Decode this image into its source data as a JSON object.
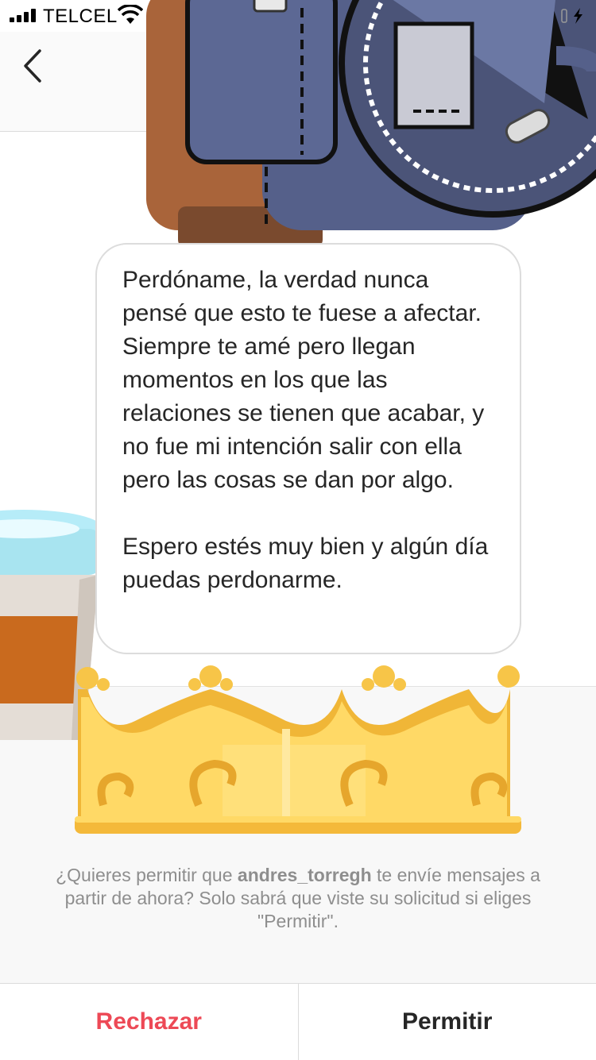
{
  "status_bar": {
    "carrier": "TELCEL",
    "icons": [
      "signal-icon",
      "wifi-icon",
      "charging-icon"
    ]
  },
  "header": {
    "back_icon": "chevron-left-icon"
  },
  "message": {
    "paragraphs": [
      "Perdóname, la verdad nunca pensé que esto te fuese a afectar. Siempre te amé pero llegan momentos en los que las relaciones se tienen que acabar, y no fue mi intención salir con ella pero las cosas se dan por algo.",
      "Espero estés muy bien y algún día puedas perdonarme."
    ]
  },
  "request": {
    "prefix": "¿Quieres permitir que ",
    "username": "andres_torregh",
    "suffix": " te envíe mensajes a partir de ahora? Solo sabrá que viste su solicitud si eliges \"Permitir\"."
  },
  "actions": {
    "decline_label": "Rechazar",
    "allow_label": "Permitir"
  },
  "colors": {
    "decline": "#ed4956",
    "text": "#262626",
    "muted": "#8e8e8e",
    "crown": "#f7c548",
    "backpack": "#59648c",
    "coffee_lid": "#a8e4f0"
  },
  "illustrations": [
    "backpack-sticker",
    "coffee-cup-sticker",
    "crown-sticker"
  ]
}
